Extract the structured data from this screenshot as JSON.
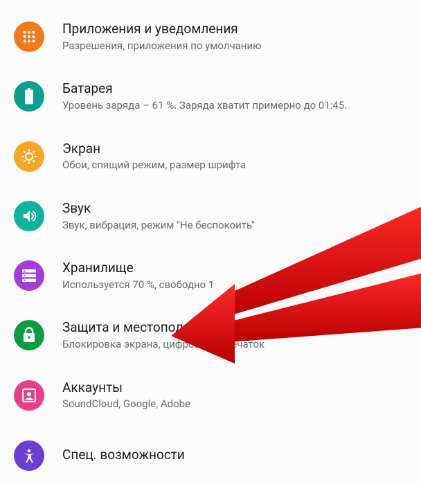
{
  "settings": {
    "items": [
      {
        "title": "Приложения и уведомления",
        "sub": "Разрешения, приложения по умолчанию"
      },
      {
        "title": "Батарея",
        "sub": "Уровень заряда – 61 %. Заряда хватит примерно до 01:45."
      },
      {
        "title": "Экран",
        "sub": "Обои, спящий режим, размер шрифта"
      },
      {
        "title": "Звук",
        "sub": "Звук, вибрация, режим \"Не беспокоить\""
      },
      {
        "title": "Хранилище",
        "sub": "Используется 70 %, свободно 1"
      },
      {
        "title": "Защита и местоположение",
        "sub": "Блокировка экрана, цифровой отпечаток"
      },
      {
        "title": "Аккаунты",
        "sub": "SoundCloud, Google, Adobe"
      },
      {
        "title": "Спец. возможности",
        "sub": ""
      }
    ]
  }
}
